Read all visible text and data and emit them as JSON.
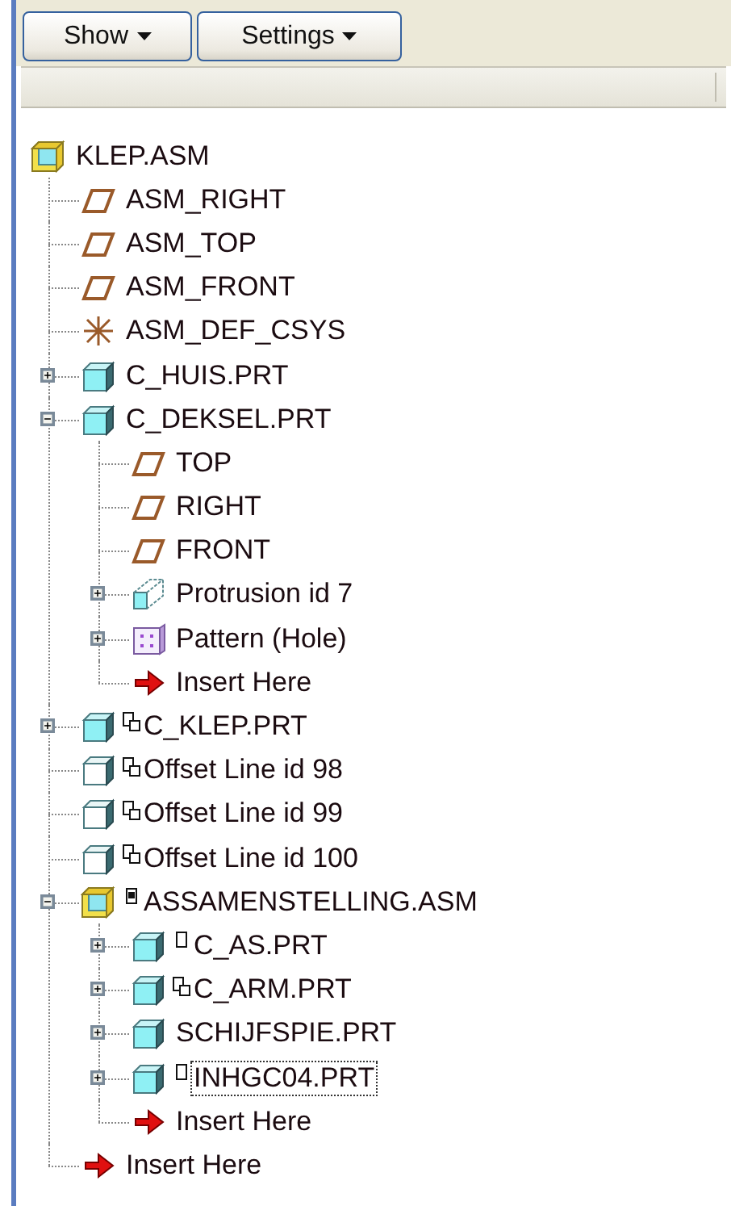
{
  "toolbar": {
    "buttons": [
      {
        "label": "Show",
        "caret": true
      },
      {
        "label": "Settings",
        "caret": true
      }
    ]
  },
  "tree": {
    "items": [
      {
        "label": "KLEP.ASM",
        "kind": "assembly",
        "linked": false,
        "marked": false,
        "dotted": false,
        "selected": false,
        "children": [
          {
            "label": "ASM_RIGHT",
            "kind": "datum-plane",
            "linked": false,
            "marked": false,
            "dotted": false,
            "selected": false
          },
          {
            "label": "ASM_TOP",
            "kind": "datum-plane",
            "linked": false,
            "marked": false,
            "dotted": false,
            "selected": false
          },
          {
            "label": "ASM_FRONT",
            "kind": "datum-plane",
            "linked": false,
            "marked": false,
            "dotted": false,
            "selected": false
          },
          {
            "label": "ASM_DEF_CSYS",
            "kind": "csys",
            "linked": false,
            "marked": false,
            "dotted": false,
            "selected": false
          },
          {
            "label": "C_HUIS.PRT",
            "kind": "part",
            "linked": false,
            "marked": false,
            "dotted": false,
            "selected": false,
            "expanded": false
          },
          {
            "label": "C_DEKSEL.PRT",
            "kind": "part",
            "linked": false,
            "marked": false,
            "dotted": false,
            "selected": false,
            "expanded": true,
            "children": [
              {
                "label": "TOP",
                "kind": "datum-plane",
                "linked": false,
                "marked": false,
                "dotted": false,
                "selected": false
              },
              {
                "label": "RIGHT",
                "kind": "datum-plane",
                "linked": false,
                "marked": false,
                "dotted": false,
                "selected": false
              },
              {
                "label": "FRONT",
                "kind": "datum-plane",
                "linked": false,
                "marked": false,
                "dotted": false,
                "selected": false
              },
              {
                "label": "Protrusion id 7",
                "kind": "protrusion",
                "linked": false,
                "marked": false,
                "dotted": false,
                "selected": false,
                "expanded": false
              },
              {
                "label": "Pattern (Hole)",
                "kind": "pattern",
                "linked": false,
                "marked": false,
                "dotted": false,
                "selected": false,
                "expanded": false
              },
              {
                "label": "Insert Here",
                "kind": "insert",
                "linked": false,
                "marked": false,
                "dotted": false,
                "selected": false
              }
            ]
          },
          {
            "label": "C_KLEP.PRT",
            "kind": "part",
            "linked": true,
            "marked": false,
            "dotted": false,
            "selected": false,
            "expanded": false
          },
          {
            "label": "Offset Line id 98",
            "kind": "offset",
            "linked": true,
            "marked": false,
            "dotted": false,
            "selected": false
          },
          {
            "label": "Offset Line id 99",
            "kind": "offset",
            "linked": true,
            "marked": false,
            "dotted": false,
            "selected": false
          },
          {
            "label": "Offset Line id 100",
            "kind": "offset",
            "linked": true,
            "marked": false,
            "dotted": false,
            "selected": false
          },
          {
            "label": "ASSAMENSTELLING.ASM",
            "kind": "assembly",
            "linked": false,
            "marked": true,
            "dotted": true,
            "selected": false,
            "expanded": true,
            "children": [
              {
                "label": "C_AS.PRT",
                "kind": "part",
                "linked": false,
                "marked": true,
                "dotted": false,
                "selected": false,
                "expanded": false
              },
              {
                "label": "C_ARM.PRT",
                "kind": "part",
                "linked": true,
                "marked": false,
                "dotted": false,
                "selected": false,
                "expanded": false
              },
              {
                "label": "SCHIJFSPIE.PRT",
                "kind": "part",
                "linked": false,
                "marked": false,
                "dotted": false,
                "selected": false,
                "expanded": false
              },
              {
                "label": "INHGC04.PRT",
                "kind": "part",
                "linked": false,
                "marked": true,
                "dotted": false,
                "selected": true,
                "expanded": false
              },
              {
                "label": "Insert Here",
                "kind": "insert",
                "linked": false,
                "marked": false,
                "dotted": false,
                "selected": false
              }
            ]
          },
          {
            "label": "Insert Here",
            "kind": "insert",
            "linked": false,
            "marked": false,
            "dotted": false,
            "selected": false
          }
        ]
      }
    ]
  }
}
